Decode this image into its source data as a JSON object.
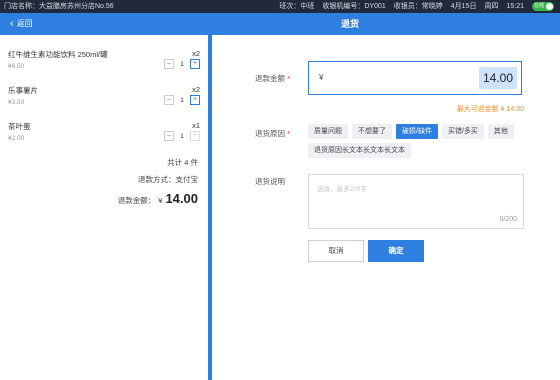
{
  "topbar": {
    "store": "门店名称：大益膳房苏州分店No.56",
    "shift": "班次：中班",
    "register": "收银机编号：DY001",
    "cashier": "收银员：常晓婷",
    "date": "4月15日",
    "weekday": "周四",
    "time": "15:21",
    "toggle_label": "在线"
  },
  "header": {
    "back_label": "返回",
    "title": "退货"
  },
  "items": [
    {
      "name": "红牛维生素功能饮料 250ml/罐",
      "qty": "x2",
      "price": "¥6.50",
      "count": "1"
    },
    {
      "name": "乐事薯片",
      "qty": "x2",
      "price": "¥3.50",
      "count": "1"
    },
    {
      "name": "茶叶蛋",
      "qty": "x1",
      "price": "¥2.00",
      "count": "1"
    }
  ],
  "summary": {
    "total_items": "共计 4 件",
    "pay_method": "退款方式：支付宝",
    "refund_label": "退款金额：",
    "currency": "¥",
    "refund_amount": "14.00"
  },
  "form": {
    "amount_label": "退款金额",
    "amount_currency": "¥",
    "amount_value": "14.00",
    "max_note": "最大可退金额 ¥ 14.00",
    "reason_label": "退货原因",
    "reasons": [
      "质量问题",
      "不想要了",
      "破损/缺件",
      "买错/多买",
      "其他",
      "退货原因长文本长文本长文本"
    ],
    "selected_reason_index": 2,
    "note_label": "退货说明",
    "note_placeholder": "选填，最多200字",
    "note_count": "0/200",
    "cancel_label": "取消",
    "confirm_label": "确定"
  },
  "colors": {
    "primary": "#2f7fe0",
    "topbar": "#202a3a",
    "warning": "#f0902a",
    "required": "#e23"
  }
}
